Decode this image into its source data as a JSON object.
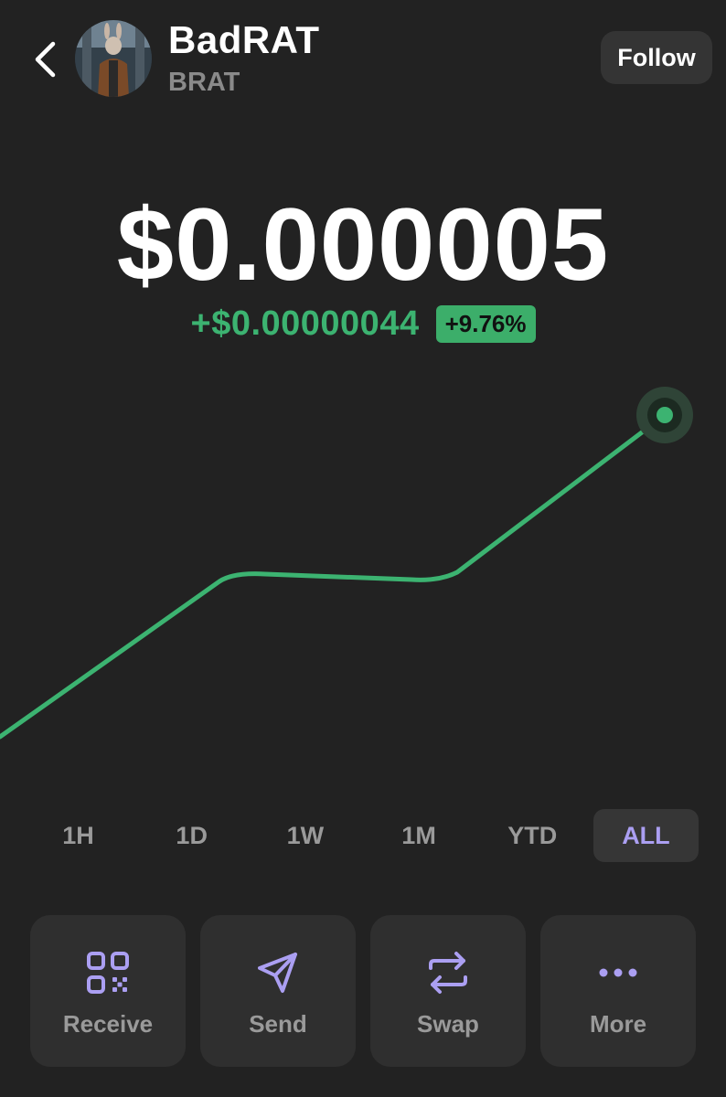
{
  "header": {
    "token_name": "BadRAT",
    "token_symbol": "BRAT",
    "follow_label": "Follow",
    "icons": {
      "back": "chevron-left-icon",
      "avatar": "token-avatar"
    }
  },
  "price": {
    "value": "$0.000005",
    "change_abs": "+$0.00000044",
    "change_pct": "+9.76%"
  },
  "colors": {
    "background": "#222222",
    "positive": "#3cb371",
    "accent": "#ab9ff2",
    "card": "#2f2f2f"
  },
  "chart_data": {
    "type": "line",
    "range": "ALL",
    "trend": "up"
  },
  "ranges": {
    "items": [
      "1H",
      "1D",
      "1W",
      "1M",
      "YTD",
      "ALL"
    ],
    "selected": "ALL"
  },
  "actions": [
    {
      "label": "Receive",
      "icon": "qr-code-icon"
    },
    {
      "label": "Send",
      "icon": "send-icon"
    },
    {
      "label": "Swap",
      "icon": "swap-icon"
    },
    {
      "label": "More",
      "icon": "more-dots-icon"
    }
  ]
}
